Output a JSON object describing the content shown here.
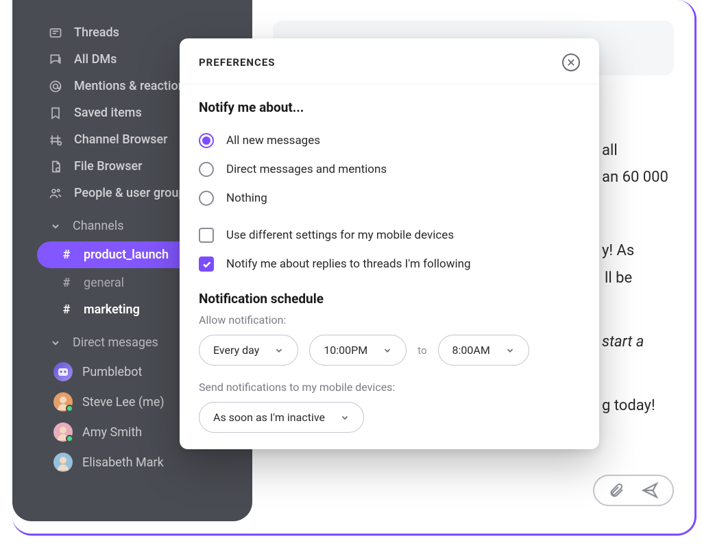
{
  "sidebar": {
    "nav": [
      {
        "icon": "threads",
        "label": "Threads"
      },
      {
        "icon": "alldms",
        "label": "All DMs"
      },
      {
        "icon": "mentions",
        "label": "Mentions & reactions"
      },
      {
        "icon": "saved",
        "label": "Saved items"
      },
      {
        "icon": "browser",
        "label": "Channel Browser"
      },
      {
        "icon": "file",
        "label": "File Browser"
      },
      {
        "icon": "people",
        "label": "People & user groups"
      }
    ],
    "channels_header": "Channels",
    "channels": [
      {
        "name": "product_launch",
        "active": true
      },
      {
        "name": "general",
        "muted": true
      },
      {
        "name": "marketing",
        "bold": true
      }
    ],
    "dms_header": "Direct mesages",
    "dms": [
      {
        "name": "Pumblebot",
        "color": "#6c78d8"
      },
      {
        "name": "Steve Lee (me)",
        "color": "#e49a5e"
      },
      {
        "name": "Amy Smith",
        "color": "#e7a8b8"
      },
      {
        "name": "Elisabeth Mark",
        "color": "#8fbedc"
      }
    ]
  },
  "messages": {
    "line1": "all",
    "line2": "an 60 000",
    "line3": "y! As",
    "line4": "ll be",
    "line5": "start a",
    "line6": "g today!"
  },
  "modal": {
    "title": "PREFERENCES",
    "notify_heading": "Notify me about...",
    "radios": {
      "all": "All new messages",
      "dm": "Direct messages and mentions",
      "nothing": "Nothing"
    },
    "checks": {
      "mobile": "Use different settings for my mobile devices",
      "threads": "Notify me about replies to threads I'm following"
    },
    "schedule_heading": "Notification schedule",
    "allow_label": "Allow notification:",
    "day_select": "Every day",
    "time_from": "10:00PM",
    "to_label": "to",
    "time_to": "8:00AM",
    "mobile_label": "Send notifications to my mobile devices:",
    "mobile_select": "As soon as I'm inactive"
  }
}
